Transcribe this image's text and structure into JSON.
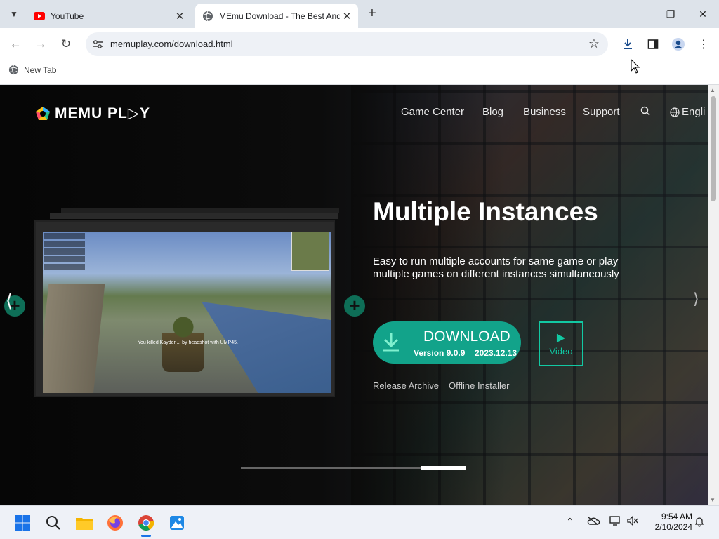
{
  "browser": {
    "tabs": [
      {
        "title": "YouTube",
        "icon": "youtube-icon"
      },
      {
        "title": "MEmu Download - The Best Android Emulator",
        "icon": "globe-icon"
      }
    ],
    "url": "memuplay.com/download.html",
    "bookmark": "New Tab"
  },
  "site": {
    "logo": "MEMU PL▷Y",
    "nav": [
      "Game Center",
      "Blog",
      "Business",
      "Support",
      "Engli"
    ],
    "heading": "Multiple Instances",
    "description": "Easy to run multiple accounts for same game or play multiple games on different instances simultaneously",
    "download_label": "DOWNLOAD",
    "version": "Version 9.0.9",
    "release_date": "2023.12.13",
    "video_label": "Video",
    "release_archive": "Release Archive",
    "offline_installer": "Offline Installer",
    "slider_progress": 0.8,
    "game_kill_message": "You killed Kayden... by headshot with UMP45."
  },
  "taskbar": {
    "time": "9:54 AM",
    "date": "2/10/2024"
  },
  "colors": {
    "accent": "#12a38a",
    "video_border": "#12c9a3",
    "tabstrip": "#dde3ea"
  }
}
